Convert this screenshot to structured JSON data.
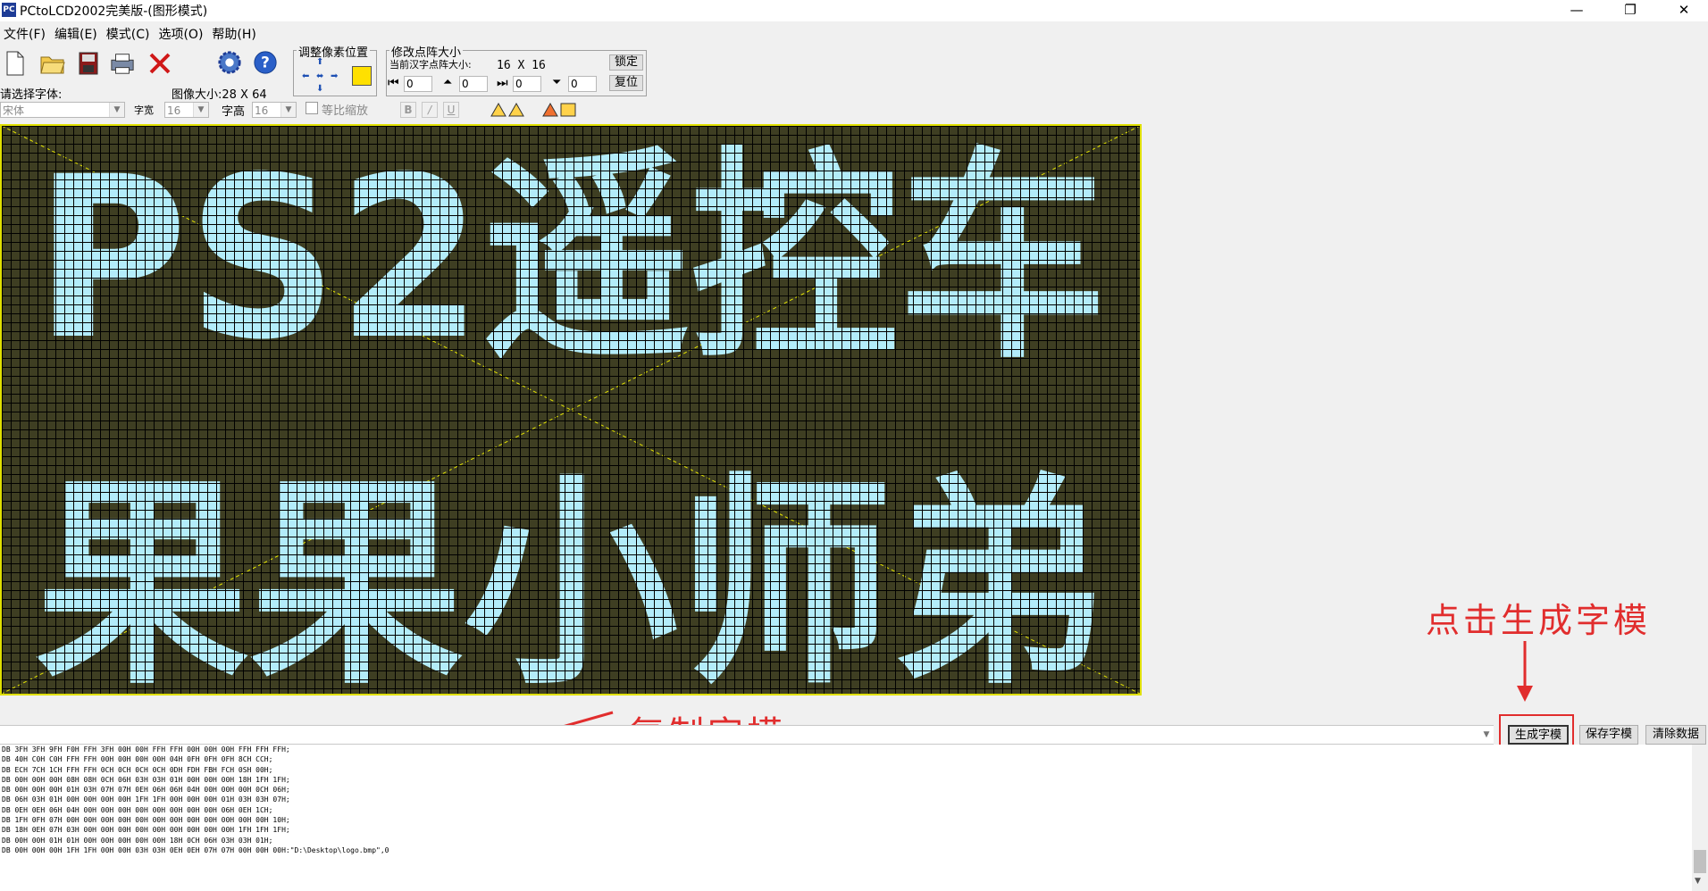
{
  "window": {
    "title": "PCtoLCD2002完美版-(图形模式)",
    "app_icon_text": "PC",
    "controls": {
      "minimize": "—",
      "maximize": "❐",
      "close": "✕"
    }
  },
  "menu": [
    "文件(F)",
    "编辑(E)",
    "模式(C)",
    "选项(O)",
    "帮助(H)"
  ],
  "toolbar": {
    "icons": [
      "new-file-icon",
      "open-folder-icon",
      "save-icon",
      "print-icon",
      "delete-icon",
      "settings-gear-icon",
      "help-icon"
    ],
    "adjust_group_title": "调整像素位置",
    "resize_group_title": "修改点阵大小",
    "current_size_label": "当前汉字点阵大小:",
    "current_size_value": "16 X 16",
    "lock_button": "锁定",
    "reset_button": "复位",
    "spin_values": [
      "0",
      "0",
      "0",
      "0"
    ],
    "font_select_label": "请选择字体:",
    "image_size_label": "图像大小:28 X 64",
    "font_value": "宋体",
    "width_label": "字宽",
    "width_value": "16",
    "height_label": "字高",
    "height_value": "16",
    "ratio_label": "等比缩放",
    "bold": "B",
    "italic": "/",
    "underline": "U"
  },
  "canvas": {
    "row1": "PS2遥控车",
    "row2": "果果小师弟",
    "pixel_color": "#b3ecfa",
    "background_color": "#3e3e22",
    "border_color": "#e0e000"
  },
  "actions": {
    "generate": "生成字模",
    "save": "保存字模",
    "clear": "清除数据"
  },
  "annotations": {
    "generate_hint": "点击生成字模",
    "copy_hint": "复制字模"
  },
  "output_lines": [
    "DB 3FH 3FH 9FH F0H FFH 3FH 00H 00H FFH FFH 00H 00H 00H FFH FFH FFH;",
    "DB 40H C0H C0H FFH FFH 00H 00H 00H 00H 04H 0FH 0FH 0FH 8CH CCH;",
    "DB ECH 7CH 1CH FFH FFH 0CH 0CH 0CH 0CH 0DH FDH FBH FCH 0SH 00H;",
    "DB 00H 00H 00H 08H 08H 0CH 06H 03H 03H 01H 00H 00H 00H 18H 1FH 1FH;",
    "DB 00H 00H 00H 01H 03H 07H 07H 0EH 06H 06H 04H 00H 00H 00H 0CH 06H;",
    "DB 06H 03H 01H 00H 00H 00H 00H 1FH 1FH 00H 00H 00H 01H 03H 03H 07H;",
    "DB 0EH 0EH 06H 04H 00H 00H 00H 00H 00H 00H 00H 00H 06H 0EH 1CH;",
    "DB 1FH 0FH 07H 00H 00H 00H 00H 00H 00H 00H 00H 00H 00H 00H 00H 10H;",
    "DB 18H 0EH 07H 03H 00H 00H 00H 00H 00H 00H 00H 00H 00H 1FH 1FH 1FH;",
    "DB 00H 00H 01H 01H 00H 00H 00H 00H 00H 18H 0CH 06H 03H 03H 01H;",
    "DB 00H 00H 00H 1FH 1FH 00H 00H 03H 03H 0EH 0EH 07H 07H 00H 00H 00H:\"D:\\Desktop\\logo.bmp\",0"
  ]
}
